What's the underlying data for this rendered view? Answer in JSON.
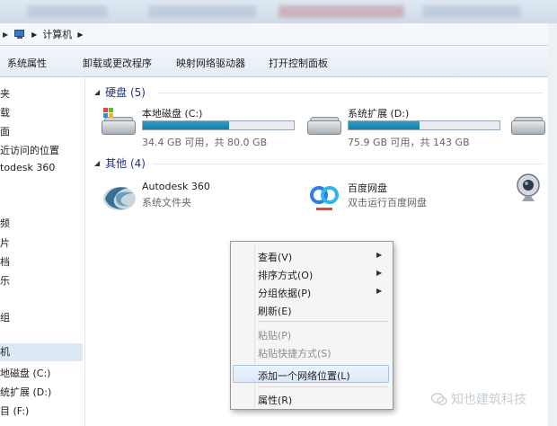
{
  "address": {
    "crumb": "计算机"
  },
  "toolbar": {
    "items": [
      "系统属性",
      "卸载或更改程序",
      "映射网络驱动器",
      "打开控制面板"
    ]
  },
  "sidebar": {
    "items": [
      {
        "label": "夹"
      },
      {
        "label": "载"
      },
      {
        "label": "面"
      },
      {
        "label": "近访问的位置"
      },
      {
        "label": "todesk 360"
      },
      {
        "label": "频"
      },
      {
        "label": "片"
      },
      {
        "label": "档"
      },
      {
        "label": "乐"
      },
      {
        "label": "组"
      },
      {
        "label": "机"
      },
      {
        "label": "地磁盘 (C:)"
      },
      {
        "label": "统扩展 (D:)"
      },
      {
        "label": "目 (F:)"
      }
    ]
  },
  "groups": {
    "hdd": {
      "label": "硬盘 (5)"
    },
    "other": {
      "label": "其他 (4)"
    }
  },
  "drives": [
    {
      "name": "本地磁盘 (C:)",
      "info": "34.4 GB 可用，共 80.0 GB",
      "used_fraction": 0.57
    },
    {
      "name": "系统扩展 (D:)",
      "info": "75.9 GB 可用，共 143 GB",
      "used_fraction": 0.47
    }
  ],
  "others": [
    {
      "name": "Autodesk 360",
      "sub": "系统文件夹"
    },
    {
      "name": "百度网盘",
      "sub": "双击运行百度网盘"
    }
  ],
  "context_menu": {
    "view": "查看(V)",
    "sort": "排序方式(O)",
    "group": "分组依据(P)",
    "refresh": "刷新(E)",
    "paste": "粘贴(P)",
    "paste_shortcut": "粘贴快捷方式(S)",
    "add_network": "添加一个网络位置(L)",
    "properties": "属性(R)"
  },
  "watermark": {
    "text": "知也建筑科技"
  },
  "colors": {
    "bar_fill": "#1c7fa8",
    "highlight": "#dbe8f8",
    "group_header": "#1e3287"
  }
}
